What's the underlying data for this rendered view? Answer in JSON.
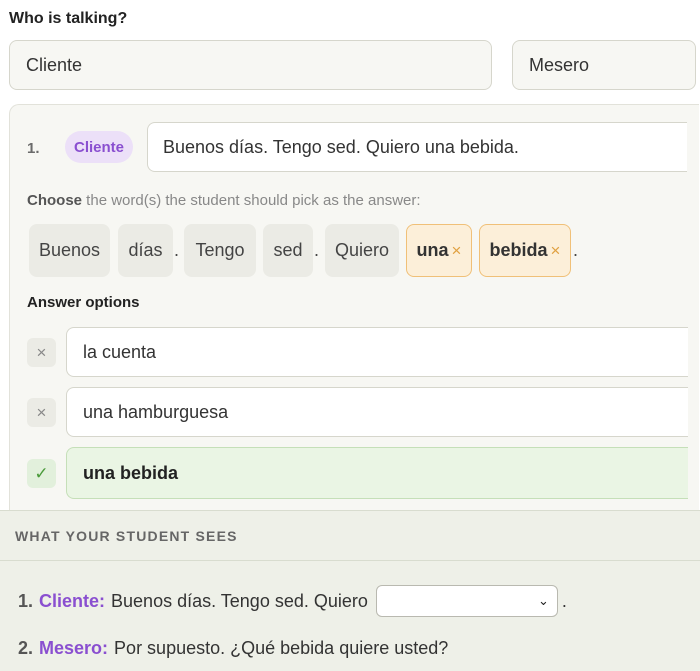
{
  "who_heading": "Who is talking?",
  "speakers": [
    "Cliente",
    "Mesero"
  ],
  "line": {
    "number": "1.",
    "speaker": "Cliente",
    "text": "Buenos días. Tengo sed. Quiero una bebida."
  },
  "choose": {
    "bold": "Choose",
    "rest": " the word(s) the student should pick as the answer:"
  },
  "tokens": [
    {
      "text": "Buenos",
      "selected": false
    },
    {
      "text": "días",
      "selected": false
    },
    {
      "text": ".",
      "punct": true
    },
    {
      "text": "Tengo",
      "selected": false
    },
    {
      "text": "sed",
      "selected": false
    },
    {
      "text": ".",
      "punct": true
    },
    {
      "text": "Quiero",
      "selected": false
    },
    {
      "text": "una",
      "selected": true
    },
    {
      "text": "bebida",
      "selected": true
    },
    {
      "text": ".",
      "punct": true
    }
  ],
  "remove_glyph": "×",
  "answer_heading": "Answer options",
  "answers": [
    {
      "text": "la cuenta",
      "correct": false,
      "mark": "×"
    },
    {
      "text": "una hamburguesa",
      "correct": false,
      "mark": "×"
    },
    {
      "text": "una bebida",
      "correct": true,
      "mark": "✓"
    }
  ],
  "preview": {
    "heading": "WHAT YOUR STUDENT SEES",
    "lines": [
      {
        "number": "1.",
        "speaker": "Cliente:",
        "text": "Buenos días. Tengo sed. Quiero",
        "has_select": true,
        "after": "."
      },
      {
        "number": "2.",
        "speaker": "Mesero:",
        "text": "Por supuesto. ¿Qué bebida quiere usted?",
        "has_select": false,
        "after": ""
      }
    ],
    "select_arrow": "⌄"
  }
}
